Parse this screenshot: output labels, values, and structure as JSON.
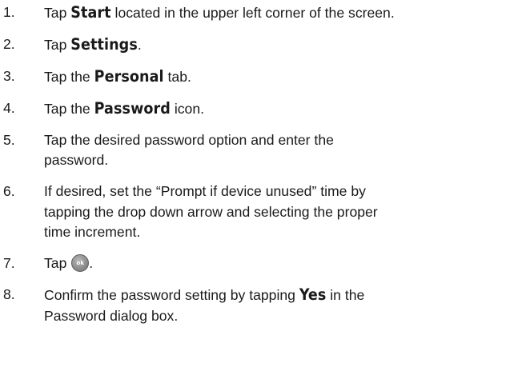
{
  "steps": [
    {
      "number": "1.",
      "parts": [
        {
          "t": "Tap "
        },
        {
          "t": "Start",
          "bold": true
        },
        {
          "t": " located in the upper left corner of the screen."
        }
      ]
    },
    {
      "number": "2.",
      "parts": [
        {
          "t": "Tap "
        },
        {
          "t": "Settings",
          "bold": true
        },
        {
          "t": "."
        }
      ]
    },
    {
      "number": "3.",
      "parts": [
        {
          "t": "Tap the "
        },
        {
          "t": "Personal",
          "bold": true
        },
        {
          "t": " tab."
        }
      ]
    },
    {
      "number": "4.",
      "parts": [
        {
          "t": "Tap the "
        },
        {
          "t": "Password",
          "bold": true
        },
        {
          "t": " icon."
        }
      ]
    },
    {
      "number": "5.",
      "lines": [
        [
          {
            "t": "Tap the desired password option and enter the"
          }
        ],
        [
          {
            "t": "password."
          }
        ]
      ]
    },
    {
      "number": "6.",
      "lines": [
        [
          {
            "t": "If desired, set the “Prompt if device unused” time by"
          }
        ],
        [
          {
            "t": "tapping the drop down arrow and selecting the proper"
          }
        ],
        [
          {
            "t": "time increment."
          }
        ]
      ]
    },
    {
      "number": "7.",
      "parts": [
        {
          "t": "Tap "
        },
        {
          "icon": "ok-button-icon",
          "label": "ok"
        },
        {
          "t": "."
        }
      ]
    },
    {
      "number": "8.",
      "lines": [
        [
          {
            "t": "Confirm the password setting by tapping "
          },
          {
            "t": "Yes",
            "bold": true
          },
          {
            "t": " in the"
          }
        ],
        [
          {
            "t": "Password dialog box."
          }
        ]
      ]
    }
  ]
}
